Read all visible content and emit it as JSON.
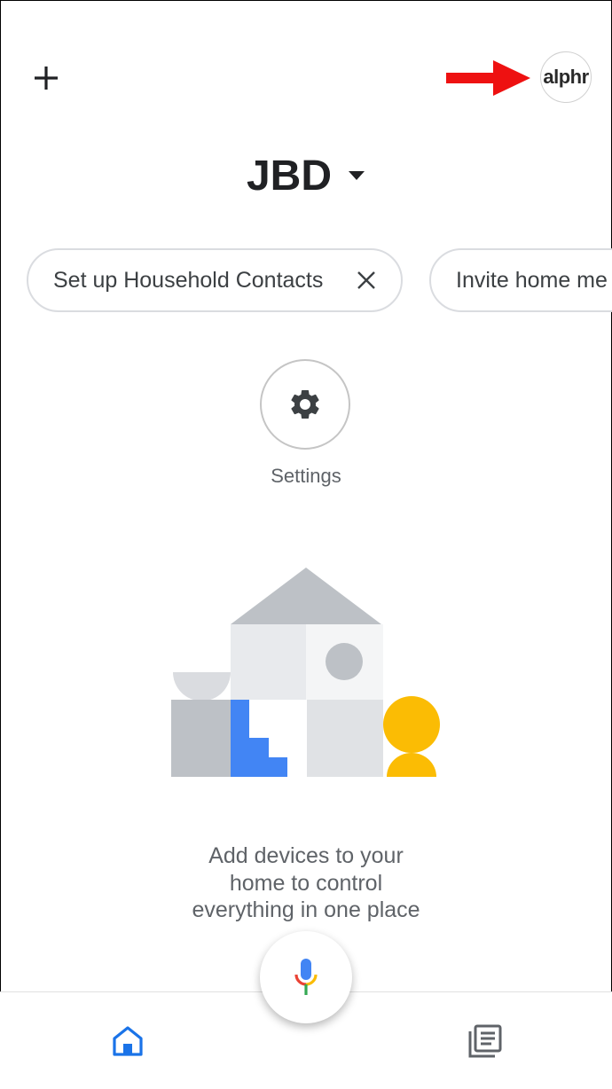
{
  "header": {
    "add_icon": "plus-icon",
    "avatar_text": "alphr",
    "annotation_arrow_color": "#ee1111"
  },
  "home": {
    "name": "JBD",
    "dropdown_icon": "caret-down-icon"
  },
  "chips": [
    {
      "label": "Set up Household Contacts",
      "dismiss_icon": "close-icon"
    },
    {
      "label": "Invite home me"
    }
  ],
  "settings": {
    "label": "Settings",
    "icon": "gear-icon"
  },
  "empty_state": {
    "line1": "Add devices to your",
    "line2": "home to control",
    "line3": "everything in one place"
  },
  "bottom_nav": {
    "home_icon": "home-icon",
    "feed_icon": "feed-icon",
    "mic_icon": "mic-icon",
    "active_color": "#1a73e8"
  },
  "colors": {
    "blue": "#4285f4",
    "yellow": "#fbbc04",
    "red": "#ea4335",
    "green": "#34a853",
    "gray_light": "#e8eaed",
    "gray_mid": "#bdc1c6"
  }
}
